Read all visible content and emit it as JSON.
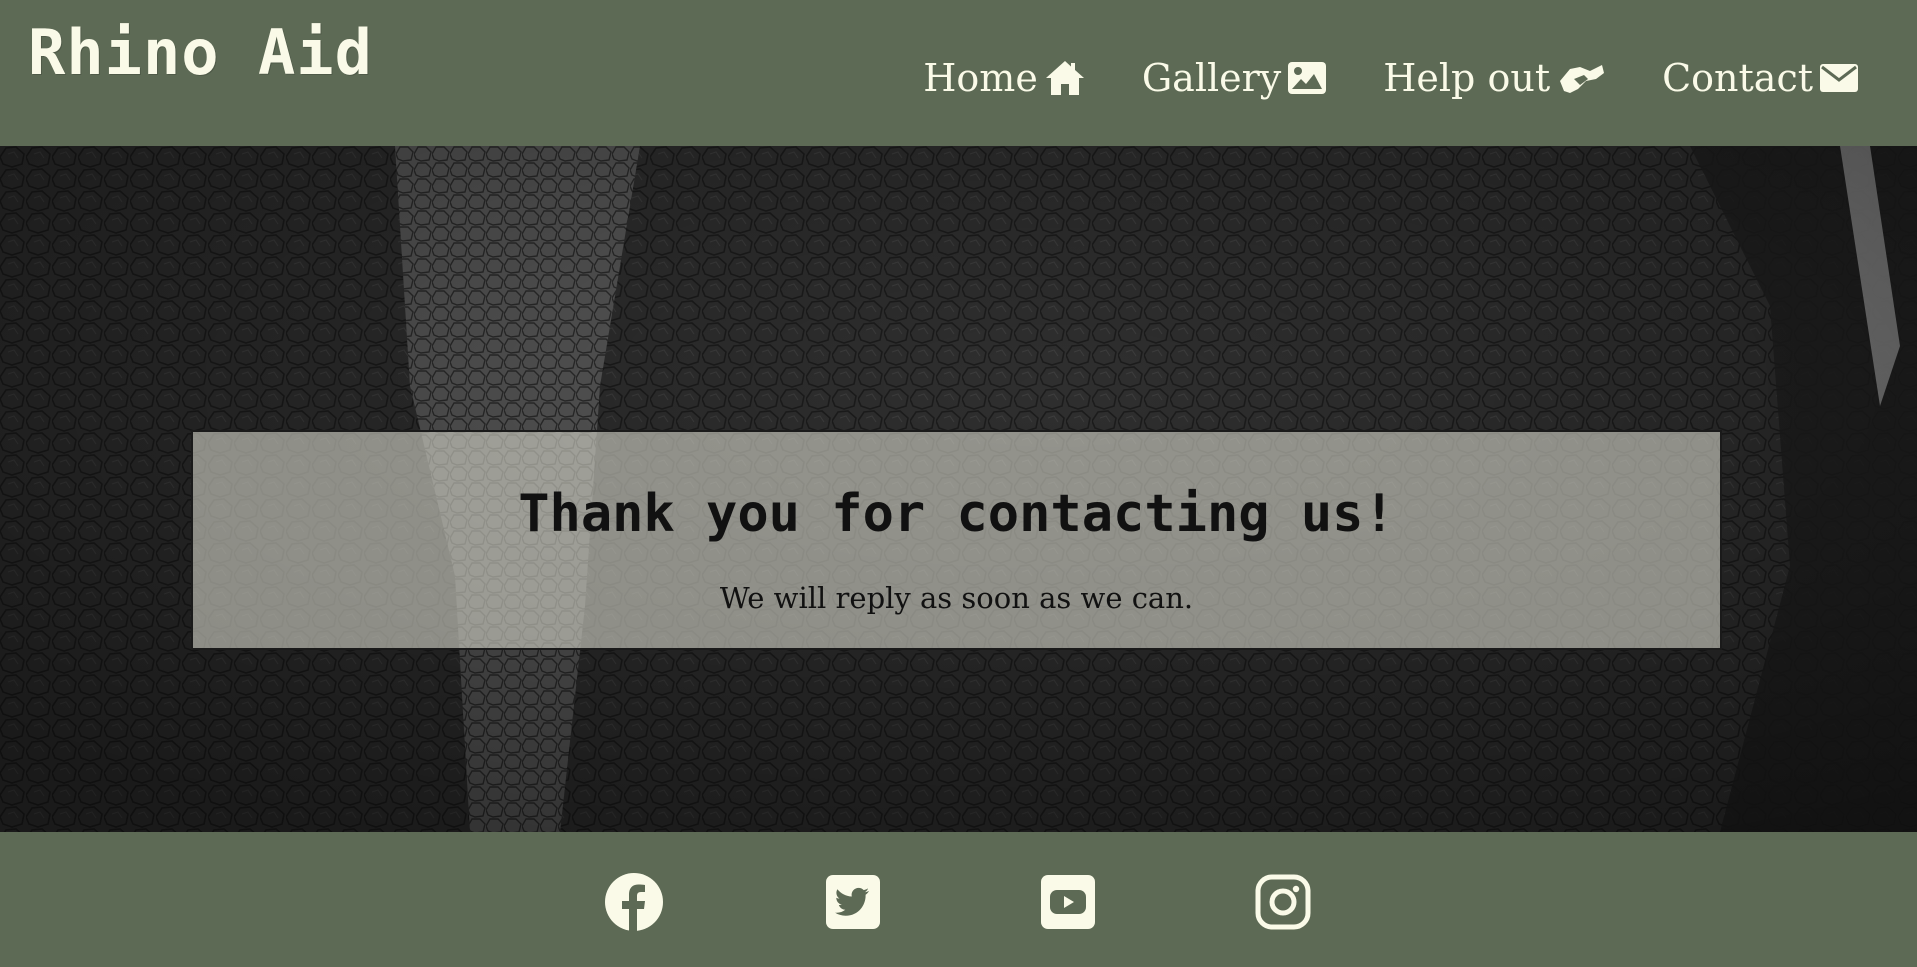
{
  "header": {
    "logo": "Rhino Aid",
    "nav": [
      {
        "label": "Home",
        "icon": "home-icon"
      },
      {
        "label": "Gallery",
        "icon": "image-icon"
      },
      {
        "label": "Help out",
        "icon": "handshake-icon"
      },
      {
        "label": "Contact",
        "icon": "envelope-icon"
      }
    ]
  },
  "message": {
    "title": "Thank you for contacting us!",
    "text": "We will reply as soon as we can."
  },
  "footer": {
    "social": [
      {
        "icon": "facebook-icon"
      },
      {
        "icon": "twitter-icon"
      },
      {
        "icon": "youtube-icon"
      },
      {
        "icon": "instagram-icon"
      }
    ]
  },
  "colors": {
    "brand_green": "#5d6a55",
    "text_cream": "#fafae8",
    "box_overlay": "#d2d2c6"
  }
}
